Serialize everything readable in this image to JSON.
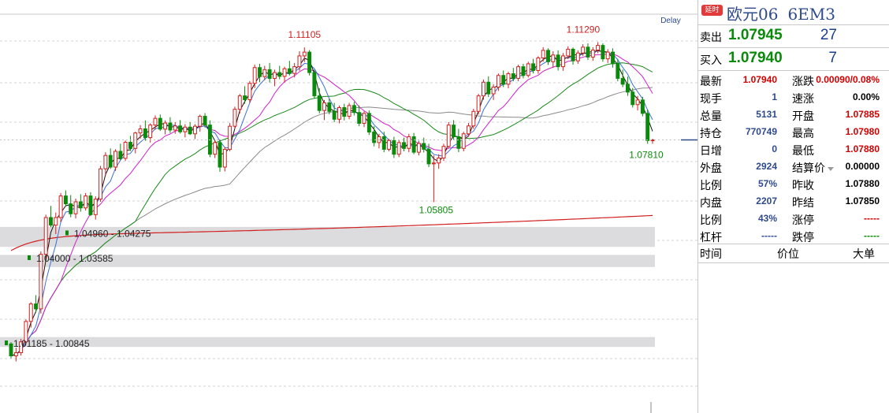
{
  "chart": {
    "delay_label": "Delay",
    "annotations": {
      "high_left": "1.11105",
      "high_right": "1.11290",
      "low_mid": "1.05805",
      "last_price": "1.07810"
    },
    "zones": [
      {
        "label": "1.04960 - 1.04275",
        "from": 1.0496,
        "to": 1.04275
      },
      {
        "label": "1.04000 - 1.03585",
        "from": 1.04,
        "to": 1.03585
      },
      {
        "label": "1.01185 - 1.00845",
        "from": 1.01185,
        "to": 1.00845
      }
    ]
  },
  "chart_data": {
    "type": "candlestick",
    "title": "",
    "ylim": [
      0.995,
      1.1225
    ],
    "bar_count": 130,
    "zones": [
      [
        1.04275,
        1.0496
      ],
      [
        1.03585,
        1.04
      ],
      [
        1.00845,
        1.01185
      ]
    ],
    "labelled_points": [
      {
        "label": "1.11105",
        "index": 59,
        "value": 1.11105
      },
      {
        "label": "1.11290",
        "index": 119,
        "value": 1.1129
      },
      {
        "label": "1.05805",
        "index": 85,
        "value": 1.05805
      },
      {
        "label": "1.07810",
        "index": 129,
        "value": 1.0781
      }
    ],
    "ohlc": [
      [
        1.0095,
        1.0101,
        1.0046,
        1.0054
      ],
      [
        1.0054,
        1.0082,
        1.0035,
        1.0065
      ],
      [
        1.0065,
        1.0112,
        1.0055,
        1.0102
      ],
      [
        1.0102,
        1.0179,
        1.0093,
        1.0172
      ],
      [
        1.0172,
        1.0238,
        1.0151,
        1.0232
      ],
      [
        1.0232,
        1.0262,
        1.0202,
        1.0215
      ],
      [
        1.0215,
        1.0412,
        1.0199,
        1.0402
      ],
      [
        1.0402,
        1.0538,
        1.0388,
        1.0528
      ],
      [
        1.0528,
        1.0568,
        1.0495,
        1.0502
      ],
      [
        1.0502,
        1.0545,
        1.0471,
        1.0528
      ],
      [
        1.0528,
        1.0612,
        1.0512,
        1.0602
      ],
      [
        1.0602,
        1.0621,
        1.0566,
        1.0575
      ],
      [
        1.0575,
        1.0605,
        1.0529,
        1.0541
      ],
      [
        1.0541,
        1.0593,
        1.0525,
        1.0582
      ],
      [
        1.0582,
        1.0608,
        1.0548,
        1.0561
      ],
      [
        1.0561,
        1.0612,
        1.0552,
        1.0602
      ],
      [
        1.0602,
        1.0615,
        1.0533,
        1.0538
      ],
      [
        1.0538,
        1.0601,
        1.0521,
        1.0591
      ],
      [
        1.0591,
        1.0705,
        1.0582,
        1.0695
      ],
      [
        1.0695,
        1.0752,
        1.0671,
        1.0741
      ],
      [
        1.0741,
        1.0765,
        1.0695,
        1.0701
      ],
      [
        1.0701,
        1.0762,
        1.0688,
        1.0755
      ],
      [
        1.0755,
        1.0781,
        1.0725,
        1.0731
      ],
      [
        1.0731,
        1.0792,
        1.0722,
        1.0786
      ],
      [
        1.0786,
        1.0808,
        1.0756,
        1.0765
      ],
      [
        1.0765,
        1.0822,
        1.0748,
        1.0818
      ],
      [
        1.0818,
        1.0845,
        1.0798,
        1.0832
      ],
      [
        1.0832,
        1.0861,
        1.0791,
        1.0802
      ],
      [
        1.0802,
        1.0851,
        1.0785,
        1.0845
      ],
      [
        1.0845,
        1.0878,
        1.0829,
        1.0868
      ],
      [
        1.0868,
        1.0881,
        1.0825,
        1.0831
      ],
      [
        1.0831,
        1.0861,
        1.0813,
        1.0852
      ],
      [
        1.0852,
        1.0872,
        1.0818,
        1.0828
      ],
      [
        1.0828,
        1.0855,
        1.0815,
        1.0842
      ],
      [
        1.0842,
        1.0862,
        1.0816,
        1.0822
      ],
      [
        1.0822,
        1.0848,
        1.0803,
        1.0838
      ],
      [
        1.0838,
        1.0855,
        1.0811,
        1.0815
      ],
      [
        1.0815,
        1.0848,
        1.0797,
        1.0841
      ],
      [
        1.0841,
        1.0881,
        1.0822,
        1.0875
      ],
      [
        1.0875,
        1.0886,
        1.0836,
        1.0845
      ],
      [
        1.0845,
        1.0861,
        1.0735,
        1.0745
      ],
      [
        1.0745,
        1.0792,
        1.0732,
        1.0785
      ],
      [
        1.0785,
        1.0795,
        1.0685,
        1.0701
      ],
      [
        1.0701,
        1.0769,
        1.0686,
        1.0762
      ],
      [
        1.0762,
        1.0852,
        1.0755,
        1.0841
      ],
      [
        1.0841,
        1.0908,
        1.0832,
        1.0899
      ],
      [
        1.0899,
        1.0952,
        1.0885,
        1.0945
      ],
      [
        1.0945,
        1.0978,
        1.0918,
        1.0932
      ],
      [
        1.0932,
        1.0996,
        1.0921,
        1.0988
      ],
      [
        1.0988,
        1.1052,
        1.0972,
        1.1042
      ],
      [
        1.1042,
        1.1055,
        1.0992,
        1.1011
      ],
      [
        1.1011,
        1.1048,
        1.0999,
        1.1035
      ],
      [
        1.1035,
        1.1058,
        1.0991,
        1.1005
      ],
      [
        1.1005,
        1.1035,
        1.0978,
        1.1025
      ],
      [
        1.1025,
        1.1048,
        1.1002,
        1.1012
      ],
      [
        1.1012,
        1.1045,
        1.0991,
        1.1038
      ],
      [
        1.1038,
        1.1065,
        1.1015,
        1.1022
      ],
      [
        1.1022,
        1.1058,
        1.1008,
        1.1045
      ],
      [
        1.1045,
        1.1098,
        1.1031,
        1.1082
      ],
      [
        1.1082,
        1.1111,
        1.1061,
        1.1095
      ],
      [
        1.1095,
        1.1102,
        1.1015,
        1.1025
      ],
      [
        1.1025,
        1.1035,
        1.0935,
        1.0945
      ],
      [
        1.0945,
        1.0972,
        1.0885,
        1.0895
      ],
      [
        1.0895,
        1.0931,
        1.0862,
        1.0921
      ],
      [
        1.0921,
        1.0935,
        1.0882,
        1.0892
      ],
      [
        1.0892,
        1.0921,
        1.0855,
        1.0865
      ],
      [
        1.0865,
        1.0912,
        1.0851,
        1.0905
      ],
      [
        1.0905,
        1.0918,
        1.0861,
        1.0875
      ],
      [
        1.0875,
        1.0921,
        1.0865,
        1.0912
      ],
      [
        1.0912,
        1.0925,
        1.0878,
        1.0888
      ],
      [
        1.0888,
        1.0912,
        1.0841,
        1.0851
      ],
      [
        1.0851,
        1.0892,
        1.0838,
        1.0885
      ],
      [
        1.0885,
        1.0895,
        1.0811,
        1.0821
      ],
      [
        1.0821,
        1.0841,
        1.0772,
        1.0785
      ],
      [
        1.0785,
        1.0815,
        1.0765,
        1.0805
      ],
      [
        1.0805,
        1.0822,
        1.0752,
        1.0762
      ],
      [
        1.0762,
        1.0798,
        1.0755,
        1.0792
      ],
      [
        1.0792,
        1.0805,
        1.0732,
        1.0745
      ],
      [
        1.0745,
        1.0795,
        1.0735,
        1.0785
      ],
      [
        1.0785,
        1.0802,
        1.0755,
        1.0765
      ],
      [
        1.0765,
        1.0815,
        1.0752,
        1.0805
      ],
      [
        1.0805,
        1.0818,
        1.0745,
        1.0752
      ],
      [
        1.0752,
        1.0791,
        1.0741,
        1.0782
      ],
      [
        1.0782,
        1.0802,
        1.0751,
        1.0762
      ],
      [
        1.0762,
        1.0781,
        1.0701,
        1.0712
      ],
      [
        1.0712,
        1.0741,
        1.0581,
        1.0715
      ],
      [
        1.0715,
        1.0745,
        1.0695,
        1.0732
      ],
      [
        1.0732,
        1.0781,
        1.0722,
        1.0772
      ],
      [
        1.0772,
        1.0855,
        1.0765,
        1.0845
      ],
      [
        1.0845,
        1.0862,
        1.0795,
        1.0805
      ],
      [
        1.0805,
        1.0832,
        1.0752,
        1.0765
      ],
      [
        1.0765,
        1.0822,
        1.0755,
        1.0815
      ],
      [
        1.0815,
        1.0852,
        1.0805,
        1.0842
      ],
      [
        1.0842,
        1.0901,
        1.0832,
        1.0892
      ],
      [
        1.0892,
        1.0952,
        1.0881,
        1.0945
      ],
      [
        1.0945,
        1.1001,
        1.0932,
        1.0992
      ],
      [
        1.0992,
        1.1012,
        1.0941,
        1.0952
      ],
      [
        1.0952,
        1.0985,
        1.0931,
        1.0975
      ],
      [
        1.0975,
        1.1022,
        1.0962,
        1.1015
      ],
      [
        1.1015,
        1.1032,
        1.0975,
        1.0985
      ],
      [
        1.0985,
        1.1028,
        1.0971,
        1.1021
      ],
      [
        1.1021,
        1.1041,
        1.0995,
        1.1005
      ],
      [
        1.1005,
        1.1052,
        1.0995,
        1.1045
      ],
      [
        1.1045,
        1.1055,
        1.1005,
        1.1015
      ],
      [
        1.1015,
        1.1062,
        1.1008,
        1.1055
      ],
      [
        1.1055,
        1.1072,
        1.1022,
        1.1032
      ],
      [
        1.1032,
        1.1081,
        1.1021,
        1.1075
      ],
      [
        1.1075,
        1.1112,
        1.1062,
        1.1101
      ],
      [
        1.1101,
        1.1108,
        1.1051,
        1.1062
      ],
      [
        1.1062,
        1.1098,
        1.1041,
        1.1085
      ],
      [
        1.1085,
        1.1101,
        1.1032,
        1.1045
      ],
      [
        1.1045,
        1.1092,
        1.1031,
        1.1082
      ],
      [
        1.1082,
        1.1115,
        1.1071,
        1.1105
      ],
      [
        1.1105,
        1.1111,
        1.1052,
        1.1065
      ],
      [
        1.1065,
        1.1101,
        1.1055,
        1.1092
      ],
      [
        1.1092,
        1.1122,
        1.1082,
        1.1112
      ],
      [
        1.1112,
        1.1125,
        1.1068,
        1.1078
      ],
      [
        1.1078,
        1.1112,
        1.1065,
        1.1102
      ],
      [
        1.1102,
        1.1129,
        1.1091,
        1.1118
      ],
      [
        1.1118,
        1.1125,
        1.1062,
        1.1072
      ],
      [
        1.1072,
        1.1105,
        1.1058,
        1.1095
      ],
      [
        1.1095,
        1.1108,
        1.1042,
        1.1055
      ],
      [
        1.1055,
        1.1072,
        1.0995,
        1.1005
      ],
      [
        1.1005,
        1.1035,
        1.0975,
        1.0985
      ],
      [
        1.0985,
        1.1011,
        1.0945,
        1.0958
      ],
      [
        1.0958,
        1.0972,
        1.0905,
        1.0915
      ],
      [
        1.0915,
        1.0945,
        1.0895,
        1.0931
      ],
      [
        1.0931,
        1.0942,
        1.0875,
        1.0885
      ],
      [
        1.0885,
        1.0898,
        1.0781,
        1.0792
      ],
      [
        1.0792,
        1.0798,
        1.0781,
        1.0794
      ]
    ]
  },
  "quote": {
    "delay_badge": "延时",
    "name": "欧元06",
    "symbol": "6EM3",
    "ask_label": "卖出",
    "ask_price": "1.07945",
    "ask_vol": "27",
    "bid_label": "买入",
    "bid_price": "1.07940",
    "bid_vol": "7",
    "stats_left": [
      {
        "label": "最新",
        "value": "1.07940",
        "color": "red"
      },
      {
        "label": "现手",
        "value": "1",
        "color": "blue"
      },
      {
        "label": "总量",
        "value": "5131",
        "color": "blue"
      },
      {
        "label": "持仓",
        "value": "770749",
        "color": "blue"
      },
      {
        "label": "日增",
        "value": "0",
        "color": "blue"
      },
      {
        "label": "外盘",
        "value": "2924",
        "color": "blue"
      },
      {
        "label": "比例",
        "value": "57%",
        "color": "blue"
      },
      {
        "label": "内盘",
        "value": "2207",
        "color": "blue"
      },
      {
        "label": "比例",
        "value": "43%",
        "color": "blue"
      },
      {
        "label": "杠杆",
        "value": "-----",
        "color": "blue"
      }
    ],
    "stats_right": [
      {
        "label": "涨跌",
        "value": "0.00090/0.08%",
        "color": "red"
      },
      {
        "label": "速涨",
        "value": "0.00%",
        "color": "black"
      },
      {
        "label": "开盘",
        "value": "1.07885",
        "color": "red"
      },
      {
        "label": "最高",
        "value": "1.07980",
        "color": "red"
      },
      {
        "label": "最低",
        "value": "1.07880",
        "color": "red"
      },
      {
        "label": "结算价",
        "value": "0.00000",
        "color": "black"
      },
      {
        "label": "昨收",
        "value": "1.07880",
        "color": "black"
      },
      {
        "label": "昨结",
        "value": "1.07850",
        "color": "black"
      },
      {
        "label": "涨停",
        "value": "-----",
        "color": "red"
      },
      {
        "label": "跌停",
        "value": "-----",
        "color": "green"
      }
    ],
    "tick_headers": {
      "time": "时间",
      "price": "价位",
      "volume": "大单"
    }
  }
}
